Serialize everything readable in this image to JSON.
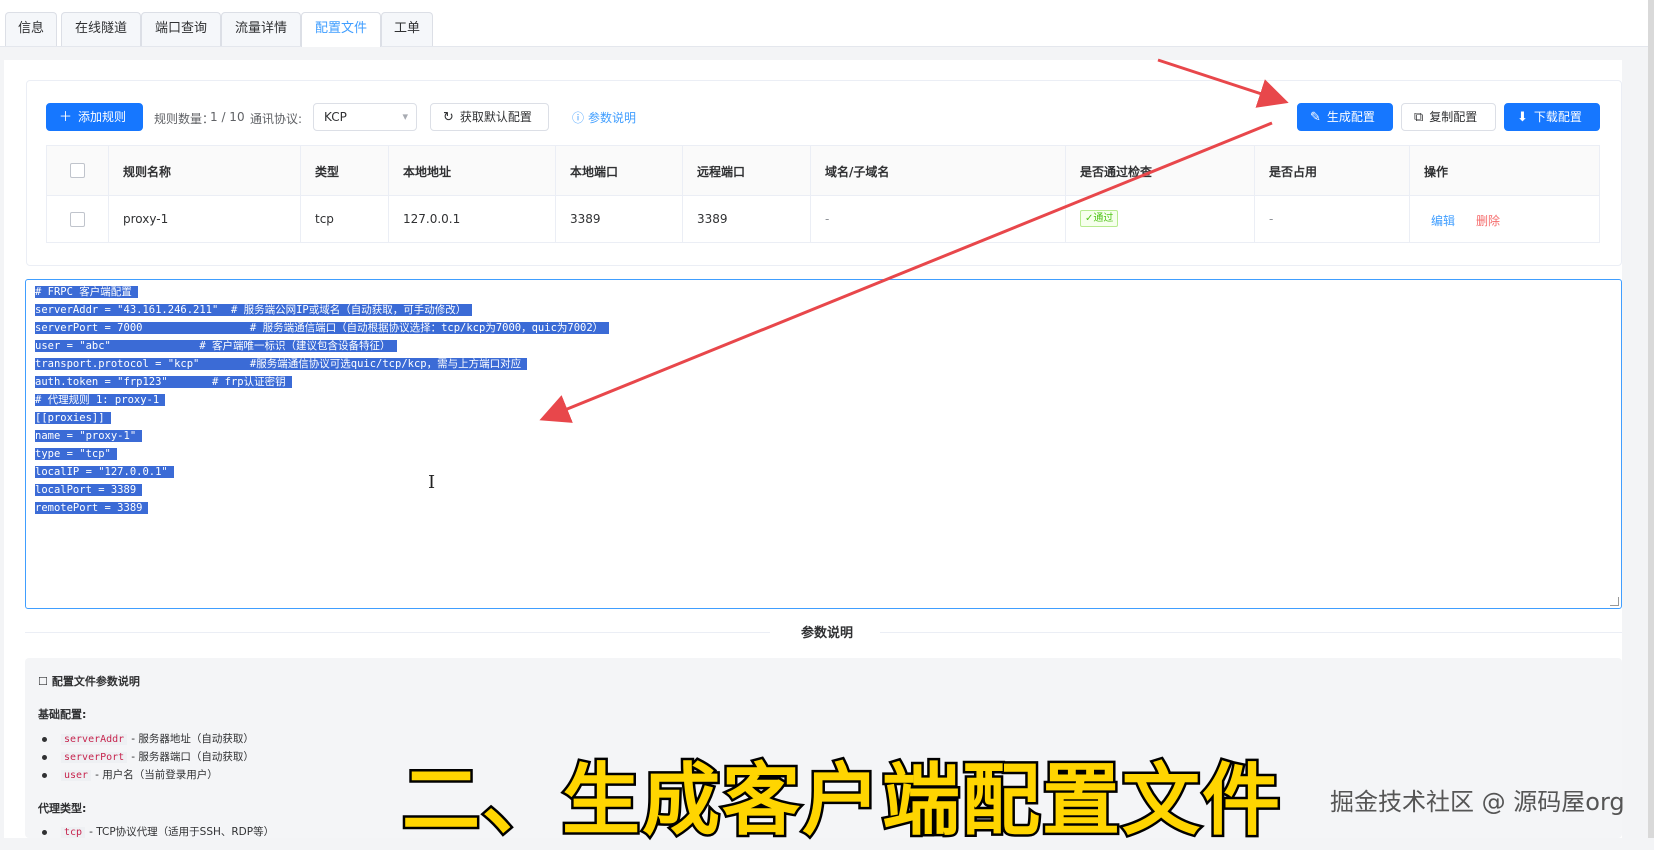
{
  "tabs": [
    "信息",
    "在线隧道",
    "端口查询",
    "流量详情",
    "配置文件",
    "工单"
  ],
  "active_tab": "配置文件",
  "toolbar": {
    "add_rule": "添加规则",
    "rule_count_label": "规则数量：",
    "rule_count_value": "1 / 10",
    "protocol_label": "通讯协议:",
    "protocol_value": "KCP",
    "get_default": "获取默认配置",
    "help_link": "参数说明",
    "generate": "生成配置",
    "copy": "复制配置",
    "download": "下载配置"
  },
  "table": {
    "headers": [
      "规则名称",
      "类型",
      "本地地址",
      "本地端口",
      "远程端口",
      "域名/子域名",
      "是否通过检查",
      "是否占用",
      "操作"
    ],
    "rows": [
      {
        "name": "proxy-1",
        "type": "tcp",
        "local_addr": "127.0.0.1",
        "local_port": "3389",
        "remote_port": "3389",
        "domain": "-",
        "check": "✓通过",
        "occupied": "-",
        "edit": "编辑",
        "delete": "删除"
      }
    ]
  },
  "config_lines": [
    "# FRPC 客户端配置",
    "serverAddr = \"43.161.246.211\"  # 服务端公网IP或域名（自动获取，可手动修改）",
    "serverPort = 7000                 # 服务端通信端口（自动根据协议选择：tcp/kcp为7000，quic为7002）",
    "user = \"abc\"              # 客户端唯一标识（建议包含设备特征）",
    "transport.protocol = \"kcp\"        #服务端通信协议可选quic/tcp/kcp，需与上方端口对应",
    "auth.token = \"frp123\"       # frp认证密钥",
    "# 代理规则 1: proxy-1",
    "[[proxies]]",
    "name = \"proxy-1\"",
    "type = \"tcp\"",
    "localIP = \"127.0.0.1\"",
    "localPort = 3389",
    "remotePort = 3389"
  ],
  "params_section_title": "参数说明",
  "doc": {
    "title": "配置文件参数说明",
    "basic_heading": "基础配置:",
    "basic_items": [
      {
        "code": "serverAddr",
        "desc": "- 服务器地址（自动获取）"
      },
      {
        "code": "serverPort",
        "desc": "- 服务器端口（自动获取）"
      },
      {
        "code": "user",
        "desc": "- 用户名（当前登录用户）"
      }
    ],
    "proxy_heading": "代理类型:",
    "proxy_items": [
      {
        "code": "tcp",
        "desc": "- TCP协议代理（适用于SSH、RDP等）"
      }
    ]
  },
  "caption": "二、生成客户端配置文件",
  "watermark": "掘金技术社区 @ 源码屋org",
  "colors": {
    "primary": "#1677ff",
    "link": "#409eff",
    "selection": "#3b6bd6",
    "delete": "#f56c6c",
    "caption": "#ffd500"
  }
}
